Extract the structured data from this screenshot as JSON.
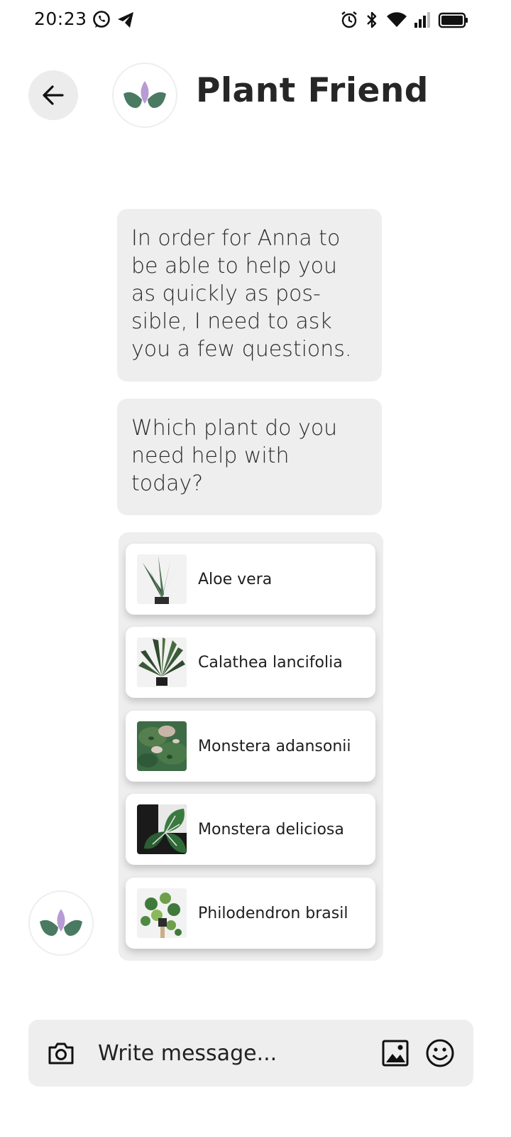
{
  "status_bar": {
    "time": "20:23",
    "icons": [
      "whatsapp-icon",
      "telegram-icon",
      "alarm-icon",
      "bluetooth-icon",
      "wifi-icon",
      "signal-icon",
      "battery-icon"
    ]
  },
  "header": {
    "title": "Plant Friend",
    "back_icon": "arrow-left-icon",
    "avatar_icon": "lotus-logo-icon"
  },
  "messages": [
    {
      "text": "In order for Anna to\nbe able to help you\nas quickly as pos-\nsible, I need to ask\nyou a few questions."
    },
    {
      "text": "Which plant do you\nneed help with\ntoday?"
    }
  ],
  "plant_options": [
    {
      "label": "Aloe vera"
    },
    {
      "label": "Calathea lancifolia"
    },
    {
      "label": "Monstera adansonii"
    },
    {
      "label": "Monstera deliciosa"
    },
    {
      "label": "Philodendron brasil"
    }
  ],
  "composer": {
    "placeholder": "Write message...",
    "camera_icon": "camera-icon",
    "gallery_icon": "image-icon",
    "emoji_icon": "emoji-icon"
  },
  "colors": {
    "bubble_bg": "#eeeeee",
    "logo_purple": "#b89bd4",
    "logo_green": "#4a7a62",
    "text": "#262626"
  }
}
